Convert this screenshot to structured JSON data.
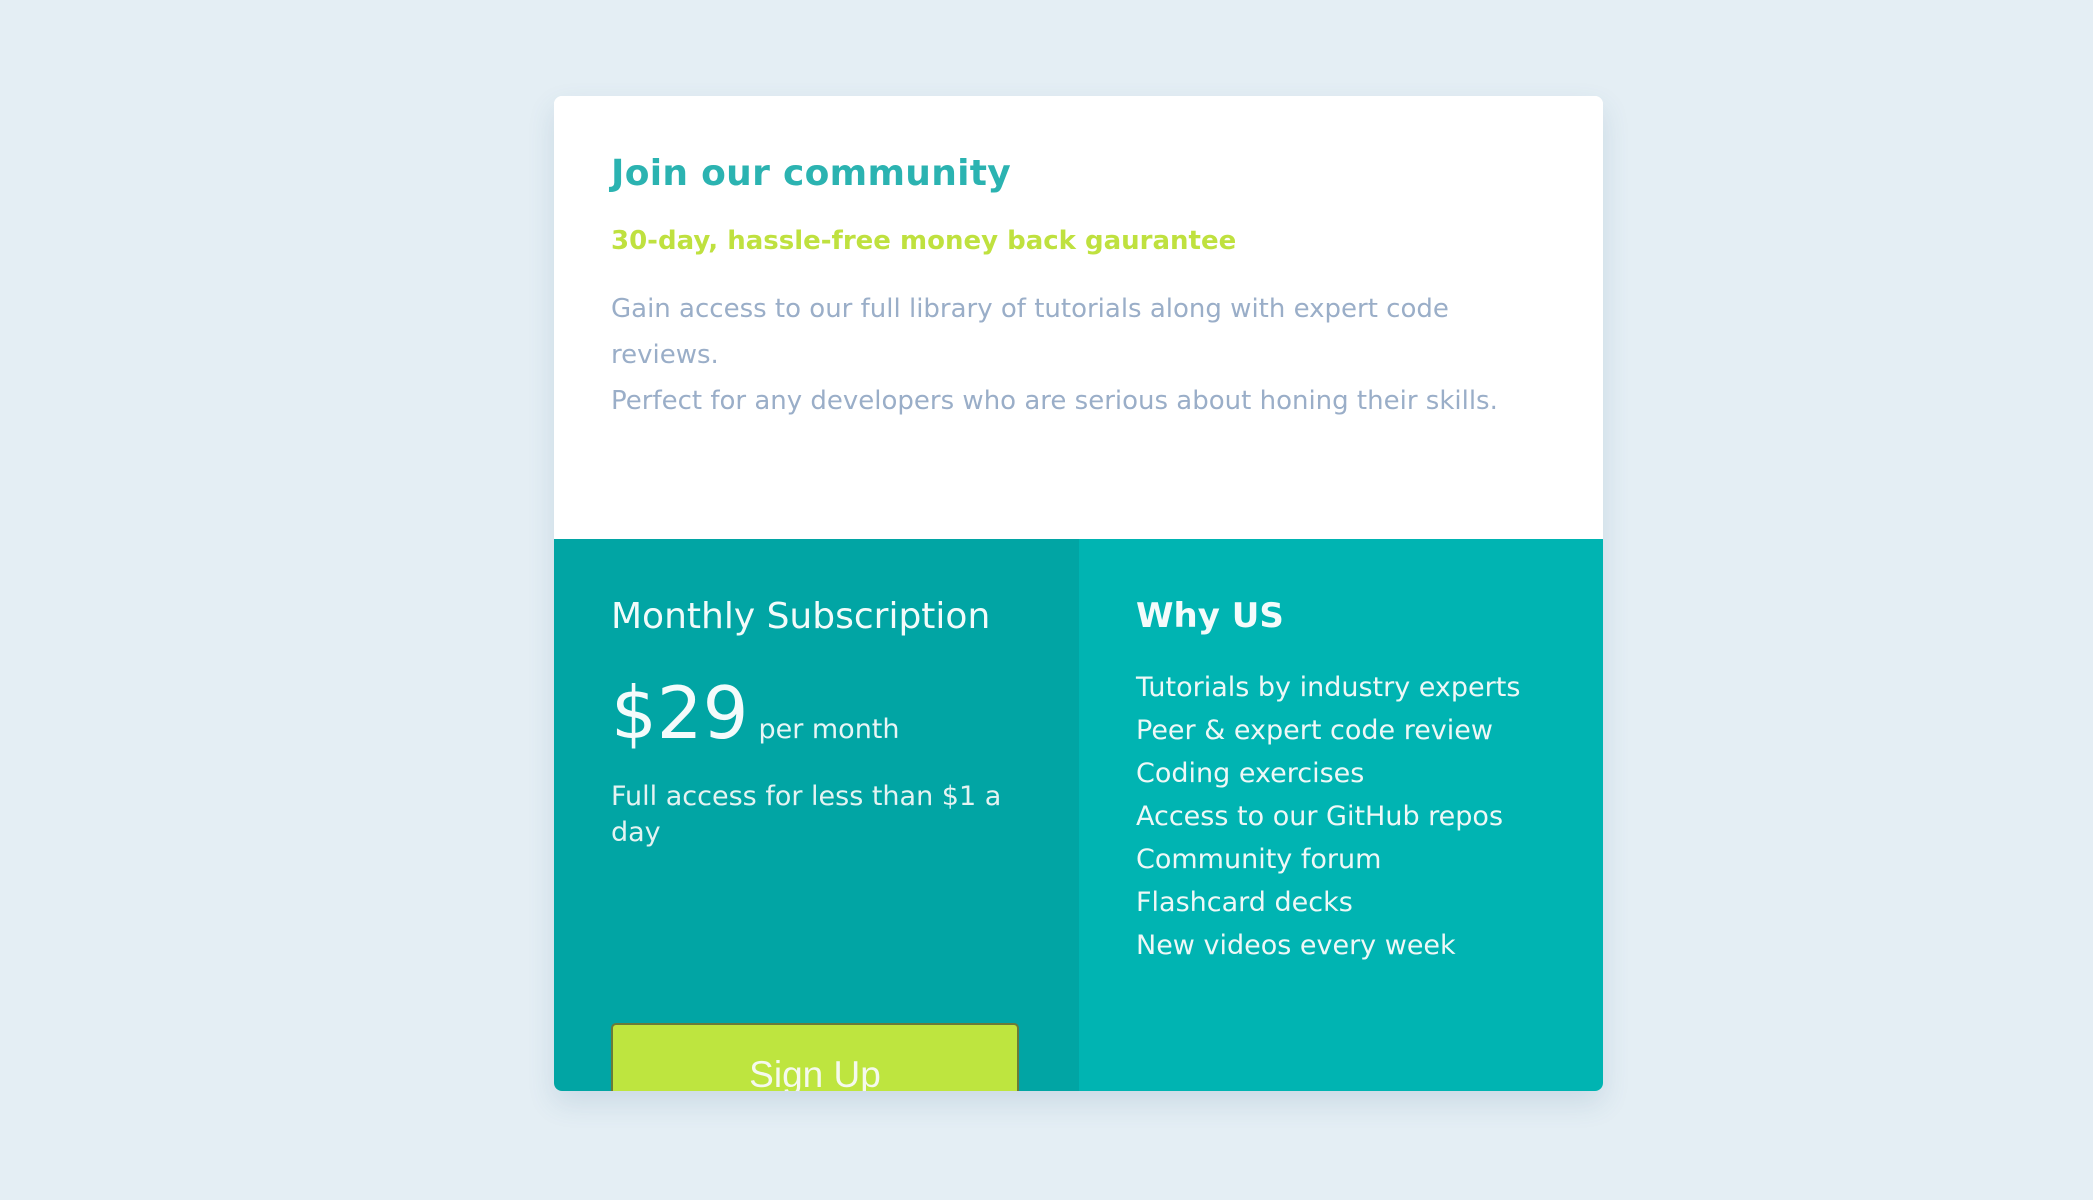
{
  "header": {
    "title": "Join our community",
    "subtitle": "30-day, hassle-free money back gaurantee",
    "description_1": "Gain access to our full library of tutorials along with expert code reviews.",
    "description_2": "Perfect for any developers who are serious about honing their skills."
  },
  "subscription": {
    "title": "Monthly Subscription",
    "price": "$29",
    "period": "per month",
    "note": "Full access for less than $1 a day",
    "button_label": "Sign Up"
  },
  "why": {
    "title": "Why US",
    "items": [
      "Tutorials by industry experts",
      "Peer & expert code review",
      "Coding exercises",
      "Access to our GitHub repos",
      "Community forum",
      "Flashcard decks",
      "New videos every week"
    ]
  },
  "colors": {
    "page_background": "#e4eef4",
    "accent_teal": "#2bb3b1",
    "accent_lime": "#bfe13f",
    "text_muted": "#9aaec8",
    "panel_left": "#01a5a4",
    "panel_right": "#00b4b2",
    "button": "#bee53f"
  }
}
